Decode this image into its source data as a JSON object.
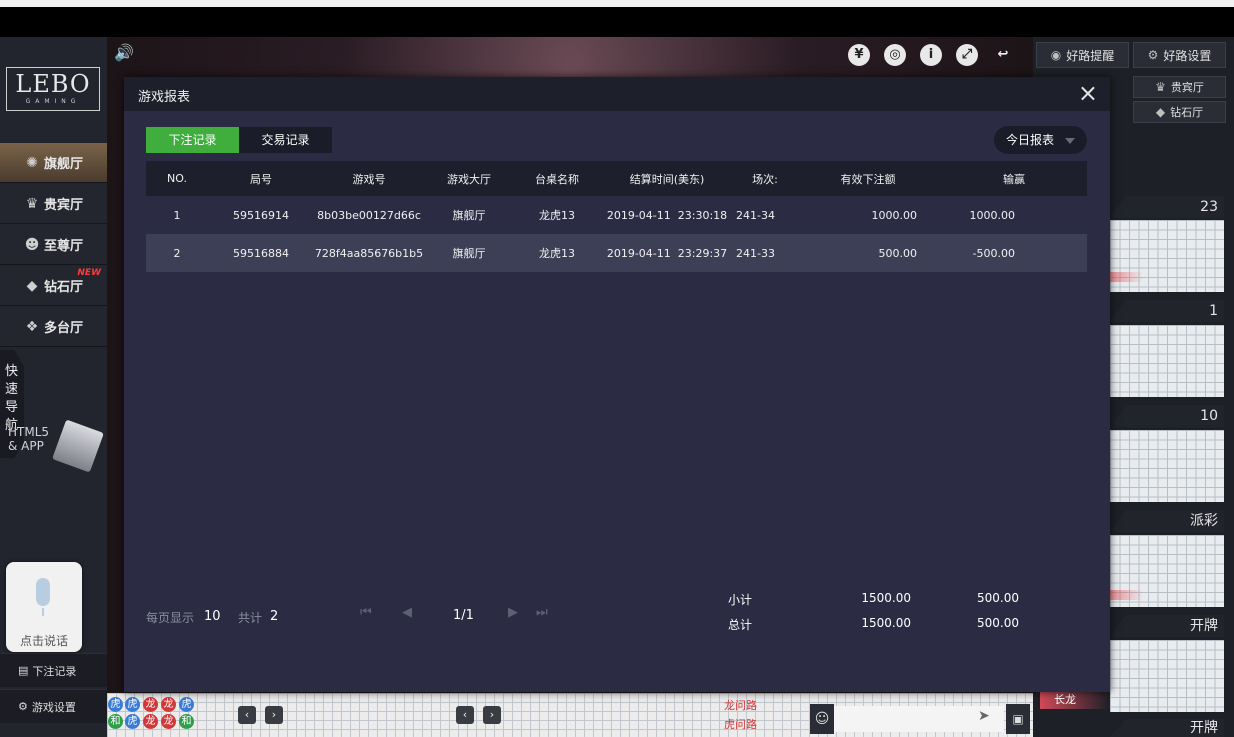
{
  "sidebar": {
    "logo_text": "LEBO",
    "logo_sub": "GAMING",
    "nav": [
      {
        "label": "旗舰厅",
        "icon": "casino-chip-icon"
      },
      {
        "label": "贵宾厅",
        "icon": "crown-icon"
      },
      {
        "label": "至尊厅",
        "icon": "dealer-icon"
      },
      {
        "label": "钻石厅",
        "icon": "diamond-icon"
      },
      {
        "label": "多台厅",
        "icon": "multi-table-icon"
      }
    ],
    "new_tag": "NEW",
    "quick_nav": [
      "快",
      "速",
      "导",
      "航"
    ],
    "html5_line1": "HTML5",
    "html5_line2": "& APP",
    "bet_record_btn": "下注记录",
    "game_settings_btn": "游戏设置"
  },
  "voice": {
    "label": "点击说话"
  },
  "right_panel": {
    "good_road_alert": "好路提醒",
    "good_road_settings": "好路设置",
    "vip_hall": "贵宾厅",
    "diamond_hall": "钻石厅",
    "roads": [
      "23",
      "1",
      "10",
      "派彩",
      "开牌"
    ],
    "long_dragon": "长龙",
    "bottom_partial": "开牌"
  },
  "bottom": {
    "dragon_road": "龙问路",
    "tiger_road": "虎问路"
  },
  "modal": {
    "title": "游戏报表",
    "close": "×",
    "tabs": [
      "下注记录",
      "交易记录"
    ],
    "report_select": "今日报表",
    "columns": [
      "NO.",
      "局号",
      "游戏号",
      "游戏大厅",
      "台桌名称",
      "结算时间(美东)",
      "场次:",
      "有效下注额",
      "输赢"
    ],
    "rows": [
      [
        "1",
        "59516914",
        "8b03be00127d66c",
        "旗舰厅",
        "龙虎13",
        "2019-04-11  23:30:18",
        "241-34",
        "1000.00",
        "1000.00"
      ],
      [
        "2",
        "59516884",
        "728f4aa85676b1b5",
        "旗舰厅",
        "龙虎13",
        "2019-04-11  23:29:37",
        "241-33",
        "500.00",
        "-500.00"
      ]
    ],
    "footer": {
      "per_page_label": "每页显示",
      "per_page": "10",
      "total_label": "共计",
      "total": "2",
      "page": "1/1",
      "subtotal_label": "小计",
      "subtotal_bet": "1500.00",
      "subtotal_win": "500.00",
      "total_sum_label": "总计",
      "total_bet": "1500.00",
      "total_win": "500.00"
    }
  }
}
